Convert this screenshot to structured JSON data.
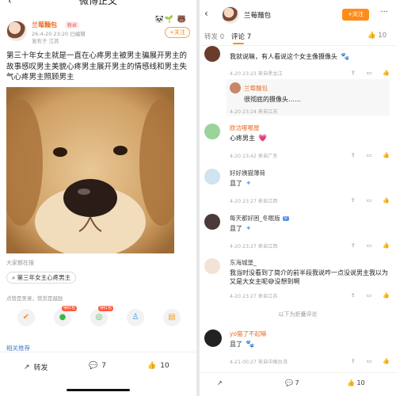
{
  "left": {
    "header_title": "微博正文",
    "author": {
      "name": "兰莓麵包",
      "tag": "粉丝",
      "time": "26-4-20 23:20",
      "edited": "已编辑",
      "source": "发布于 江苏",
      "follow": "+关注"
    },
    "post_text": "第三十年女主就是一直在心疼男主被男主骗展开男主的故事感叹男主美貌心疼男主展开男主的情感线和男主失气心疼男主照顾男主",
    "search_hint": "大家都在搜",
    "search_chip": "第三年女主心疼男主",
    "likes_line": "点赞是美意，赞赏是鼓励",
    "share_badges": [
      "得红包",
      "得红包"
    ],
    "related": "相关推荐",
    "bottom": {
      "repost": "转发",
      "comments": "7",
      "likes": "10"
    }
  },
  "right": {
    "header_name": "兰莓麵包",
    "follow": "+关注",
    "tabs": {
      "repost": "转发 0",
      "comment": "评论 7",
      "likes": "10"
    },
    "comments": [
      {
        "name": "",
        "text": "我就说嘛，有人看说这个女主像摄像头",
        "meta": "4-20 23:23 来自黑龙江",
        "likes": ""
      },
      {
        "name": "兰莓麵包",
        "text": "很彻底的摄像头……",
        "meta": "4-20 23:24 来自江苏",
        "likes": ""
      },
      {
        "name": "欧洁嘟嘟屋",
        "text": "心疼男主",
        "meta": "4-20 23:42 来自广东",
        "likes": ""
      },
      {
        "name": "好好姨猫薄荷",
        "text": "且了",
        "meta": "4-20 23:27 来自江西",
        "likes": ""
      },
      {
        "name": "每天都好困_冬眠版",
        "text": "且了",
        "meta": "4-20 23:27 来自江西",
        "likes": ""
      },
      {
        "name": "东海城堡_",
        "text": "我当时没看到了简介的前半段我说咋一点没说男主我以为又是大女主呢😅没想到啊",
        "meta": "4-20 23:27 来自江苏",
        "likes": ""
      },
      {
        "name": "yo猫了不起嘛",
        "text": "且了",
        "meta": "4-21 00:27 来自中国台湾",
        "likes": ""
      }
    ],
    "folded": "以下为折叠评论",
    "bottom": {
      "comments": "7",
      "likes": "10"
    }
  }
}
